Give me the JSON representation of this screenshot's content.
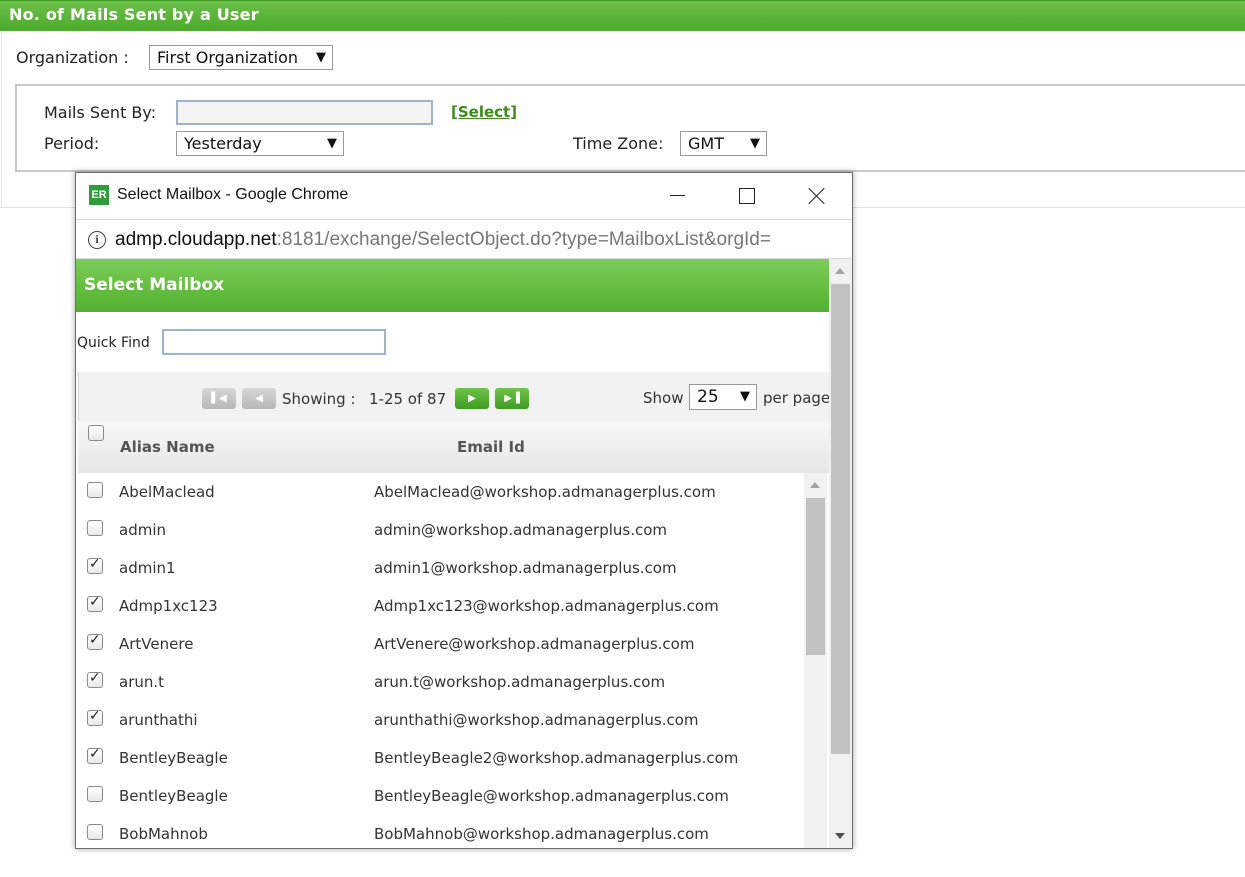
{
  "report": {
    "title": "No. of Mails Sent by a User",
    "organization_label": "Organization :",
    "organization_value": "First Organization",
    "mails_sent_by_label": "Mails Sent By:",
    "mails_sent_by_value": "",
    "select_link": "[Select]",
    "period_label": "Period:",
    "period_value": "Yesterday",
    "timezone_label": "Time Zone:",
    "timezone_value": "GMT"
  },
  "popup": {
    "window_title": "Select Mailbox - Google Chrome",
    "app_icon_text": "ER",
    "url_host": "admp.cloudapp.net",
    "url_path": ":8181/exchange/SelectObject.do?type=MailboxList&orgId=",
    "header_title": "Select Mailbox",
    "quick_find_label": "Quick Find",
    "quick_find_value": "",
    "pager": {
      "showing_label": "Showing :",
      "showing_range": "1-25 of 87",
      "show_label": "Show",
      "per_page_value": "25",
      "per_page_label": "per page"
    },
    "table": {
      "columns": [
        "Alias Name",
        "Email Id"
      ],
      "rows": [
        {
          "alias": "AbelMaclead",
          "email": "AbelMaclead@workshop.admanagerplus.com",
          "checked": false
        },
        {
          "alias": "admin",
          "email": "admin@workshop.admanagerplus.com",
          "checked": false
        },
        {
          "alias": "admin1",
          "email": "admin1@workshop.admanagerplus.com",
          "checked": true
        },
        {
          "alias": "Admp1xc123",
          "email": "Admp1xc123@workshop.admanagerplus.com",
          "checked": true
        },
        {
          "alias": "ArtVenere",
          "email": "ArtVenere@workshop.admanagerplus.com",
          "checked": true
        },
        {
          "alias": "arun.t",
          "email": "arun.t@workshop.admanagerplus.com",
          "checked": true
        },
        {
          "alias": "arunthathi",
          "email": "arunthathi@workshop.admanagerplus.com",
          "checked": true
        },
        {
          "alias": "BentleyBeagle",
          "email": "BentleyBeagle2@workshop.admanagerplus.com",
          "checked": true
        },
        {
          "alias": "BentleyBeagle",
          "email": "BentleyBeagle@workshop.admanagerplus.com",
          "checked": false
        },
        {
          "alias": "BobMahnob",
          "email": "BobMahnob@workshop.admanagerplus.com",
          "checked": false
        }
      ]
    }
  },
  "colors": {
    "header_green": "#4caa2c",
    "link_green": "#3c8c1a"
  }
}
